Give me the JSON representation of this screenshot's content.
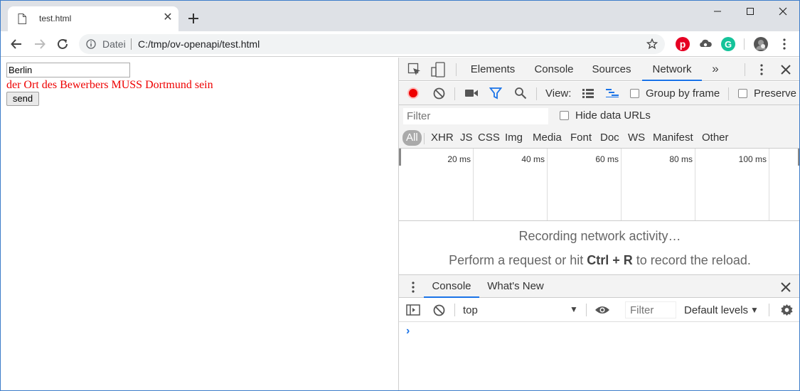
{
  "browser": {
    "tab": {
      "title": "test.html"
    },
    "address": {
      "scheme_label": "Datei",
      "url": "C:/tmp/ov-openapi/test.html"
    }
  },
  "page": {
    "city_value": "Berlin",
    "error_message": "der Ort des Bewerbers MUSS Dortmund sein",
    "send_label": "send"
  },
  "devtools": {
    "tabs": [
      "Elements",
      "Console",
      "Sources",
      "Network"
    ],
    "active_tab": "Network",
    "network": {
      "view_label": "View:",
      "group_by_frame": "Group by frame",
      "preserve_log": "Preserve l",
      "filter_placeholder": "Filter",
      "hide_data_urls": "Hide data URLs",
      "types": [
        "All",
        "XHR",
        "JS",
        "CSS",
        "Img",
        "Media",
        "Font",
        "Doc",
        "WS",
        "Manifest",
        "Other"
      ],
      "timeline_labels": [
        "20 ms",
        "40 ms",
        "60 ms",
        "80 ms",
        "100 ms"
      ],
      "empty_line1": "Recording network activity…",
      "empty_line2_before": "Perform a request or hit ",
      "empty_line2_keys": "Ctrl + R",
      "empty_line2_after": " to record the reload."
    },
    "drawer": {
      "tabs": [
        "Console",
        "What's New"
      ],
      "context": "top",
      "filter_placeholder": "Filter",
      "levels": "Default levels"
    }
  },
  "colors": {
    "error": "#ee0000",
    "record": "#ee0000",
    "accent": "#1a73e8",
    "pinterest": "#e60023",
    "grammarly": "#15c39a"
  }
}
